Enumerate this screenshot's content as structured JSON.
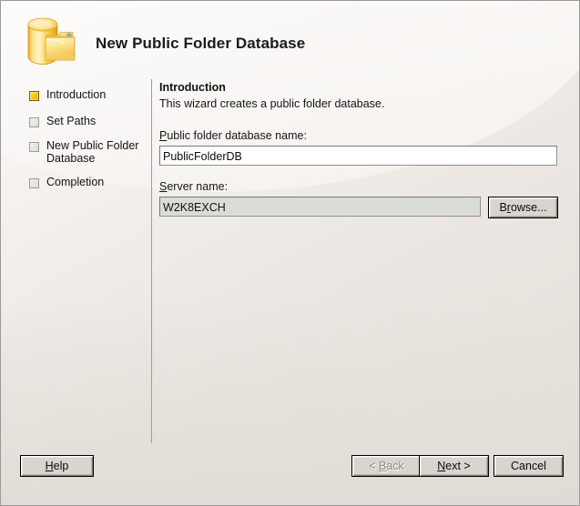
{
  "window": {
    "title": "New Public Folder Database",
    "icon": "database-folder-icon"
  },
  "sidebar": {
    "items": [
      {
        "label": "Introduction",
        "state": "active",
        "icon": "nav-square-icon"
      },
      {
        "label": "Set Paths",
        "state": "inactive",
        "icon": "nav-square-icon"
      },
      {
        "label": "New Public Folder\nDatabase",
        "state": "inactive",
        "icon": "nav-square-icon"
      },
      {
        "label": "Completion",
        "state": "inactive",
        "icon": "nav-square-icon"
      }
    ]
  },
  "content": {
    "heading": "Introduction",
    "description": "This wizard creates a public folder database.",
    "fields": [
      {
        "label_pre": "",
        "label_mnemonic": "P",
        "label_post": "ublic folder database name:",
        "value": "PublicFolderDB",
        "placeholder": "",
        "readonly": false
      },
      {
        "label_pre": "",
        "label_mnemonic": "S",
        "label_post": "erver name:",
        "value": "W2K8EXCH",
        "placeholder": "",
        "readonly": true
      }
    ],
    "browse_button": {
      "pre": "B",
      "mnemonic": "r",
      "post": "owse..."
    }
  },
  "footer": {
    "help": {
      "pre": "",
      "mnemonic": "H",
      "post": "elp"
    },
    "back": {
      "pre": "< ",
      "mnemonic": "B",
      "post": "ack",
      "disabled": true
    },
    "next": {
      "pre": "",
      "mnemonic": "N",
      "post": "ext >",
      "disabled": false
    },
    "cancel": {
      "pre": "Cancel",
      "mnemonic": "",
      "post": "",
      "disabled": false
    }
  },
  "colors": {
    "accent_gold": "#fccb14",
    "window_bg": "#e6e1dc",
    "divider": "#9c9ca4",
    "text": "#141414",
    "disabled_text": "#8c8880"
  }
}
